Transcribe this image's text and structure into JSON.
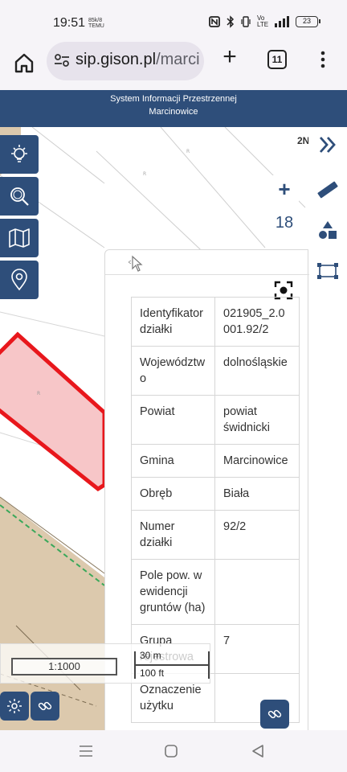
{
  "status": {
    "time": "19:51",
    "mini_top": "85k/8",
    "mini_bottom": "TEMU",
    "network": "Vo LTE",
    "battery": "23"
  },
  "browser": {
    "url_domain": "sip.gison.pl",
    "url_path": "/marci",
    "tab_count": "11"
  },
  "app": {
    "title_line1": "System Informacji Przestrzennej",
    "title_line2": "Marcinowice"
  },
  "map": {
    "zoom_level": "18",
    "zoom_in": "+",
    "zoom_out": "−",
    "corner_label": "2N",
    "scale_ratio": "1:1000",
    "scale_metric": "30 m",
    "scale_imperial": "100 ft",
    "parcel_highlight_color": "#e8171c",
    "accent_color": "#2e4e7a"
  },
  "panel": {
    "rows": [
      {
        "label": "Identyfikator działki",
        "value": "021905_2.0001.92/2"
      },
      {
        "label": "Województwo",
        "value": "dolnośląskie"
      },
      {
        "label": "Powiat",
        "value": "powiat świdnicki"
      },
      {
        "label": "Gmina",
        "value": "Marcinowice"
      },
      {
        "label": "Obręb",
        "value": "Biała"
      },
      {
        "label": "Numer działki",
        "value": "92/2"
      },
      {
        "label": "Pole pow. w ewidencji gruntów (ha)",
        "value": ""
      },
      {
        "label": "Grupa rejestrowa",
        "value": "7"
      },
      {
        "label": "Oznaczenie użytku",
        "value": ""
      }
    ]
  },
  "icons": {
    "left_tools": [
      "light-bulb-icon",
      "magnifier-icon",
      "map-icon",
      "location-pin-icon"
    ],
    "right_tools": [
      "double-chevron-right-icon",
      "ruler-icon",
      "shapes-icon",
      "polygon-select-icon"
    ]
  }
}
